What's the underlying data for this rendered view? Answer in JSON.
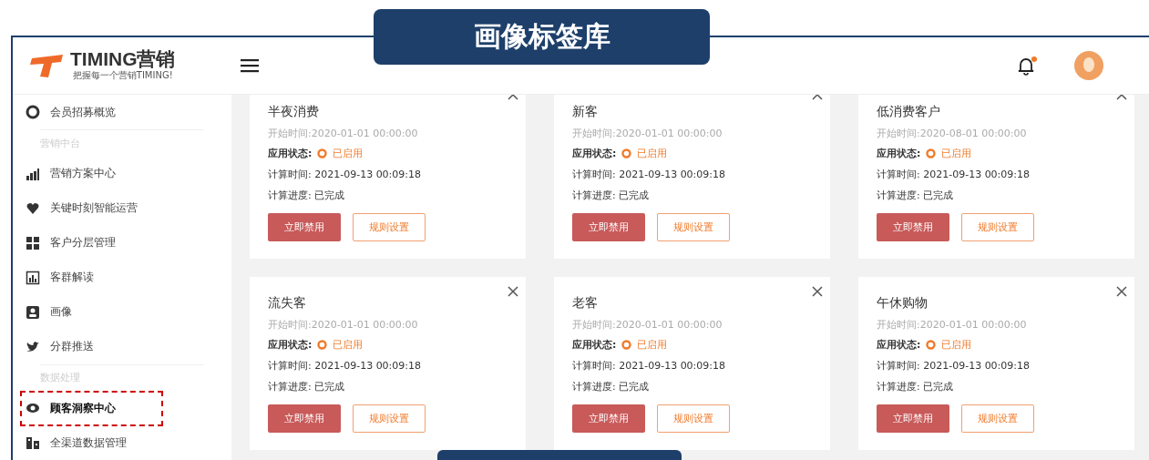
{
  "banner": {
    "title": "画像标签库"
  },
  "logo": {
    "name": "TIMING营销",
    "tagline": "把握每一个营销TIMING!"
  },
  "sidebar": {
    "items": [
      {
        "kind": "item",
        "label": "会员招募概览",
        "selected": false,
        "annotated": false
      },
      {
        "kind": "section",
        "label": "营销中台"
      },
      {
        "kind": "item",
        "label": "营销方案中心",
        "selected": false,
        "annotated": false
      },
      {
        "kind": "item",
        "label": "关键时刻智能运营",
        "selected": false,
        "annotated": false
      },
      {
        "kind": "item",
        "label": "客户分层管理",
        "selected": false,
        "annotated": false
      },
      {
        "kind": "item",
        "label": "客群解读",
        "selected": false,
        "annotated": false
      },
      {
        "kind": "item",
        "label": "画像",
        "selected": false,
        "annotated": false
      },
      {
        "kind": "item",
        "label": "分群推送",
        "selected": false,
        "annotated": false
      },
      {
        "kind": "section",
        "label": "数据处理"
      },
      {
        "kind": "item",
        "label": "顾客洞察中心",
        "selected": true,
        "annotated": true
      },
      {
        "kind": "item",
        "label": "全渠道数据管理",
        "selected": false,
        "annotated": false
      }
    ]
  },
  "header": {
    "notification_dot": true
  },
  "cards": [
    {
      "title": "半夜消费",
      "start_time": "开始时间:2020-01-01 00:00:00",
      "status_label": "应用状态:",
      "enabled": true,
      "status": "已启用",
      "calc_time": "计算时间: 2021-09-13 00:09:18",
      "progress": "计算进度: 已完成",
      "done": true,
      "primary_button": "立即禁用",
      "secondary_button": "规则设置"
    },
    {
      "title": "新客",
      "start_time": "开始时间:2020-01-01 00:00:00",
      "status_label": "应用状态:",
      "enabled": true,
      "status": "已启用",
      "calc_time": "计算时间: 2021-09-13 00:09:18",
      "progress": "计算进度: 已完成",
      "done": true,
      "primary_button": "立即禁用",
      "secondary_button": "规则设置"
    },
    {
      "title": "低消费客户",
      "start_time": "开始时间:2020-08-01 00:00:00",
      "status_label": "应用状态:",
      "enabled": true,
      "status": "已启用",
      "calc_time": "计算时间: 2021-09-13 00:09:18",
      "progress": "计算进度: 已完成",
      "done": true,
      "primary_button": "立即禁用",
      "secondary_button": "规则设置"
    },
    {
      "title": "流失客",
      "start_time": "开始时间:2020-01-01 00:00:00",
      "status_label": "应用状态:",
      "enabled": true,
      "status": "已启用",
      "calc_time": "计算时间: 2021-09-13 00:09:18",
      "progress": "计算进度: 已完成",
      "done": true,
      "primary_button": "立即禁用",
      "secondary_button": "规则设置"
    },
    {
      "title": "老客",
      "start_time": "开始时间:2020-01-01 00:00:00",
      "status_label": "应用状态:",
      "enabled": true,
      "status": "已启用",
      "calc_time": "计算时间: 2021-09-13 00:09:18",
      "progress": "计算进度: 已完成",
      "done": true,
      "primary_button": "立即禁用",
      "secondary_button": "规则设置"
    },
    {
      "title": "午休购物",
      "start_time": "开始时间:2020-01-01 00:00:00",
      "status_label": "应用状态:",
      "enabled": true,
      "status": "已启用",
      "calc_time": "计算时间: 2021-09-13 00:09:18",
      "progress": "计算进度: 已完成",
      "done": true,
      "primary_button": "立即禁用",
      "secondary_button": "规则设置"
    }
  ]
}
